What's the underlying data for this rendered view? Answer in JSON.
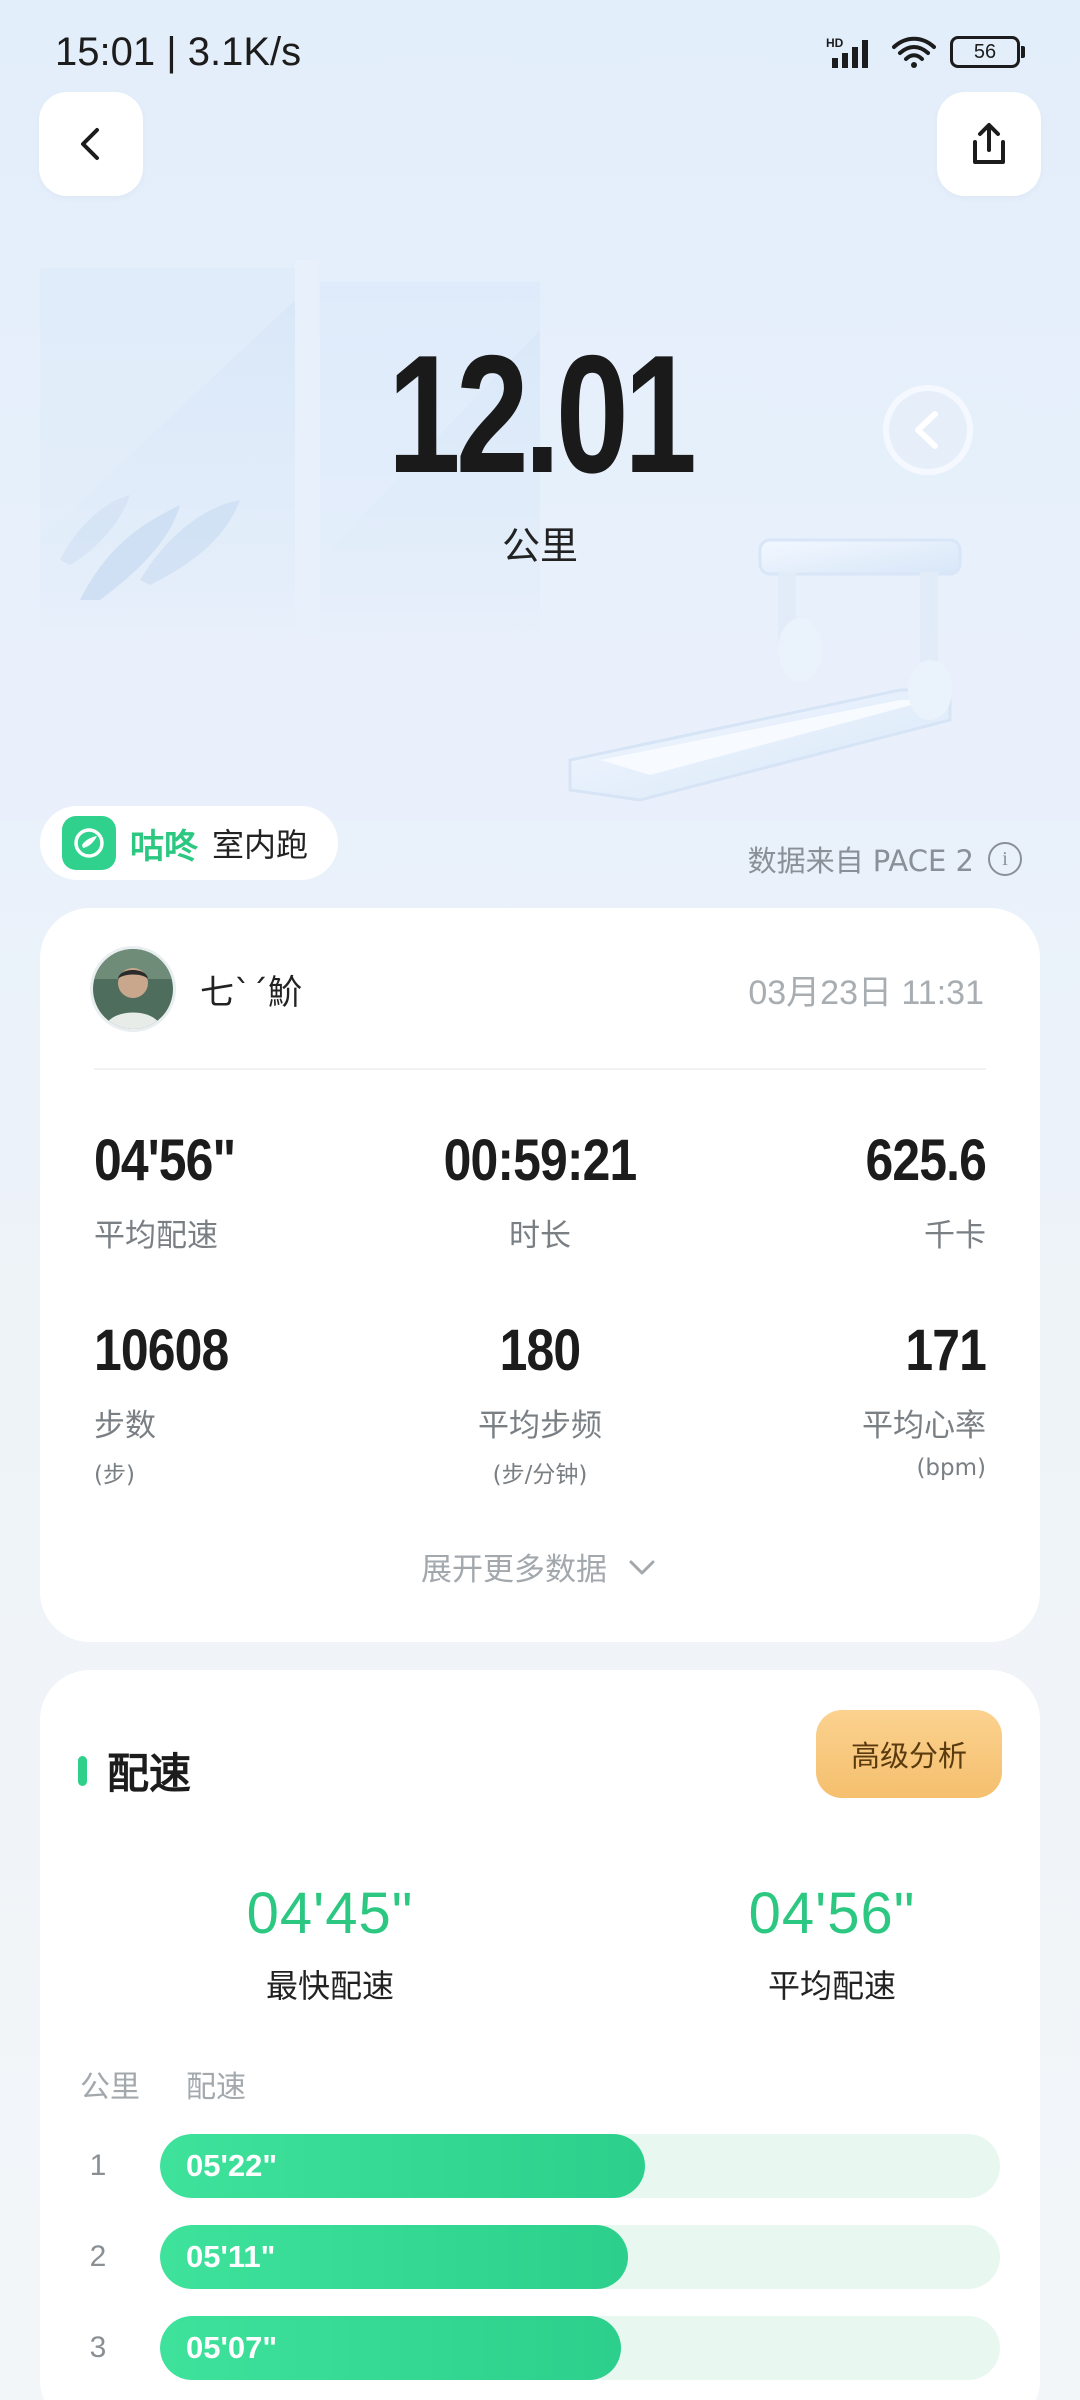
{
  "status_bar": {
    "time": "15:01 | 3.1K/s",
    "battery": "56",
    "network_badge": "HD",
    "icons": [
      "signal-icon",
      "wifi-icon",
      "battery-icon"
    ]
  },
  "header": {
    "back_icon": "chevron-left-icon",
    "share_icon": "share-icon"
  },
  "summary": {
    "distance": "12.01",
    "distance_unit": "公里"
  },
  "app": {
    "name": "咕咚",
    "mode": "室内跑",
    "data_source": "数据来自 PACE 2",
    "info_icon": "info-icon",
    "info_glyph": "i"
  },
  "record": {
    "username": "七ˋˊ魪",
    "datetime": "03月23日 11:31",
    "stats": [
      {
        "value": "04'56\"",
        "label": "平均配速",
        "sub": ""
      },
      {
        "value": "00:59:21",
        "label": "时长",
        "sub": ""
      },
      {
        "value": "625.6",
        "label": "千卡",
        "sub": ""
      },
      {
        "value": "10608",
        "label": "步数",
        "sub": "(步)"
      },
      {
        "value": "180",
        "label": "平均步频",
        "sub": "(步/分钟)"
      },
      {
        "value": "171",
        "label": "平均心率",
        "sub": "(bpm)"
      }
    ],
    "expand_label": "展开更多数据",
    "expand_icon": "chevron-down-icon"
  },
  "pace": {
    "title": "配速",
    "analysis_button": "高级分析",
    "fastest_value": "04'45\"",
    "fastest_label": "最快配速",
    "average_value": "04'56\"",
    "average_label": "平均配速",
    "col_km": "公里",
    "col_pace": "配速",
    "accent_color": "#2cc882",
    "splits": [
      {
        "km": "1",
        "pace": "05'22\"",
        "fraction": 0.577
      },
      {
        "km": "2",
        "pace": "05'11\"",
        "fraction": 0.557
      },
      {
        "km": "3",
        "pace": "05'07\"",
        "fraction": 0.549
      }
    ]
  }
}
